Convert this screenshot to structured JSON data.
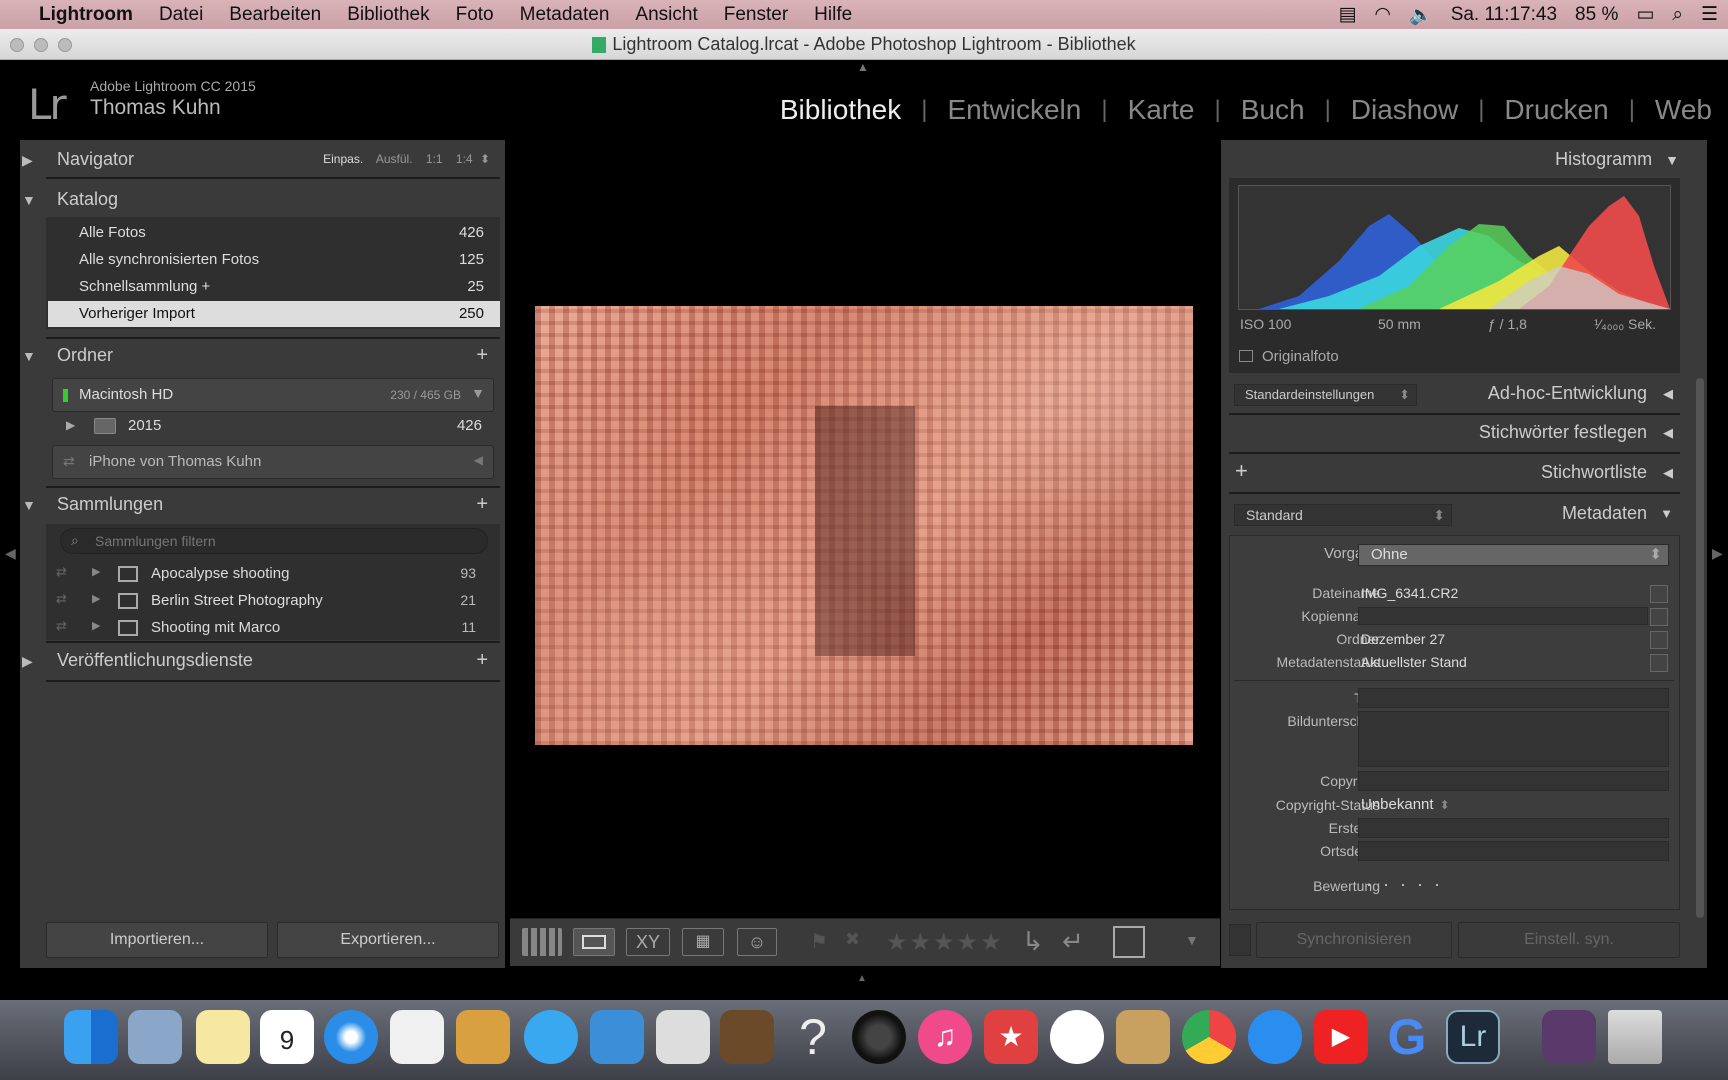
{
  "menubar": {
    "apple": "",
    "app_name": "Lightroom",
    "items": [
      "Datei",
      "Bearbeiten",
      "Bibliothek",
      "Foto",
      "Metadaten",
      "Ansicht",
      "Fenster",
      "Hilfe"
    ],
    "clock": "Sa. 11:17:43",
    "battery": "85 %"
  },
  "window": {
    "title": "Lightroom Catalog.lrcat - Adobe Photoshop Lightroom - Bibliothek"
  },
  "lr_header": {
    "logo": "Lr",
    "version": "Adobe Lightroom CC 2015",
    "user": "Thomas Kuhn",
    "modules": [
      "Bibliothek",
      "Entwickeln",
      "Karte",
      "Buch",
      "Diashow",
      "Drucken",
      "Web"
    ],
    "active_module": "Bibliothek"
  },
  "left": {
    "navigator": {
      "label": "Navigator",
      "zoom": [
        "Einpas.",
        "Ausfül.",
        "1:1",
        "1:4"
      ]
    },
    "katalog": {
      "label": "Katalog",
      "items": [
        {
          "label": "Alle Fotos",
          "count": "426"
        },
        {
          "label": "Alle synchronisierten Fotos",
          "count": "125"
        },
        {
          "label": "Schnellsammlung +",
          "count": "25"
        },
        {
          "label": "Vorheriger Import",
          "count": "250"
        }
      ]
    },
    "ordner": {
      "label": "Ordner",
      "volume": "Macintosh HD",
      "volume_size": "230 / 465 GB",
      "folder": "2015",
      "folder_count": "426",
      "device": "iPhone von Thomas Kuhn"
    },
    "sammlungen": {
      "label": "Sammlungen",
      "filter_placeholder": "Sammlungen filtern",
      "items": [
        {
          "label": "Apocalypse shooting",
          "count": "93"
        },
        {
          "label": "Berlin Street Photography",
          "count": "21"
        },
        {
          "label": "Shooting mit Marco",
          "count": "11"
        }
      ]
    },
    "veroeffentlichung": {
      "label": "Veröffentlichungsdienste"
    },
    "import_button": "Importieren...",
    "export_button": "Exportieren..."
  },
  "right": {
    "histogram": {
      "label": "Histogramm",
      "iso": "ISO 100",
      "focal": "50 mm",
      "aperture": "ƒ / 1,8",
      "shutter": "¹⁄₄₀₀₀ Sek.",
      "original": "Originalfoto"
    },
    "quick_develop": {
      "preset": "Standardeinstellungen",
      "label": "Ad-hoc-Entwicklung"
    },
    "keywords": {
      "label": "Stichwörter festlegen"
    },
    "keyword_list": {
      "plus": "+",
      "label": "Stichwortliste"
    },
    "metadata": {
      "preset_select": "Standard",
      "label": "Metadaten",
      "vorgabe_label": "Vorgabe",
      "vorgabe_value": "Ohne",
      "fields": [
        {
          "label": "Dateiname",
          "value": "IMG_6341.CR2"
        },
        {
          "label": "Kopienname",
          "value": ""
        },
        {
          "label": "Ordner",
          "value": "Dezember 27"
        },
        {
          "label": "Metadatenstatus",
          "value": "Aktuellster Stand"
        }
      ],
      "titel": "Titel",
      "bildunterschrift": "Bildunterschrift",
      "copyright": "Copyright",
      "copyright_status_label": "Copyright-Status",
      "copyright_status_value": "Unbekannt",
      "ersteller": "Ersteller",
      "ortsdetail": "Ortsdetail",
      "bewertung_label": "Bewertung",
      "bewertung_value": "· · · · ·"
    },
    "sync_button": "Synchronisieren",
    "sync_settings_button": "Einstell. syn."
  },
  "toolbar": {
    "stars": "★★★★★"
  },
  "colors": {
    "accent": "#dddddd",
    "panel": "#3a3a3a",
    "photo": "#d98a72"
  }
}
